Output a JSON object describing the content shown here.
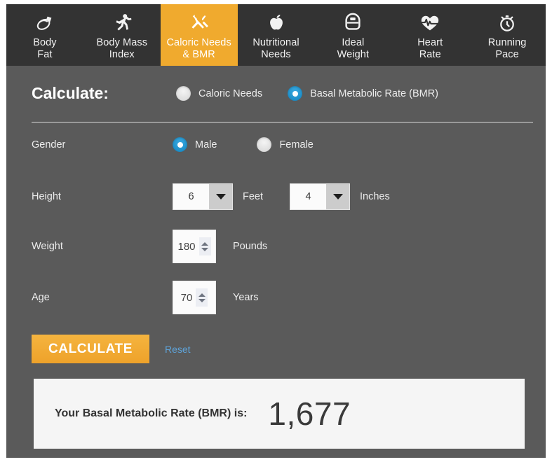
{
  "tabs": [
    {
      "label": "Body\nFat",
      "icon": "caliper-icon",
      "active": false
    },
    {
      "label": "Body Mass\nIndex",
      "icon": "runner-icon",
      "active": false
    },
    {
      "label": "Caloric Needs\n& BMR",
      "icon": "cutlery-icon",
      "active": true
    },
    {
      "label": "Nutritional\nNeeds",
      "icon": "apple-icon",
      "active": false
    },
    {
      "label": "Ideal\nWeight",
      "icon": "scale-icon",
      "active": false
    },
    {
      "label": "Heart\nRate",
      "icon": "heart-pulse-icon",
      "active": false
    },
    {
      "label": "Running\nPace",
      "icon": "stopwatch-icon",
      "active": false
    }
  ],
  "calculate": {
    "title": "Calculate:",
    "options": [
      {
        "label": "Caloric Needs",
        "selected": false
      },
      {
        "label": "Basal Metabolic Rate (BMR)",
        "selected": true
      }
    ]
  },
  "form": {
    "gender": {
      "label": "Gender",
      "options": [
        {
          "label": "Male",
          "selected": true
        },
        {
          "label": "Female",
          "selected": false
        }
      ]
    },
    "height": {
      "label": "Height",
      "feet": {
        "value": "6",
        "unit": "Feet"
      },
      "inches": {
        "value": "4",
        "unit": "Inches"
      }
    },
    "weight": {
      "label": "Weight",
      "value": "180",
      "unit": "Pounds"
    },
    "age": {
      "label": "Age",
      "value": "70",
      "unit": "Years"
    }
  },
  "actions": {
    "calculate_label": "CALCULATE",
    "reset_label": "Reset"
  },
  "result": {
    "label": "Your Basal Metabolic Rate (BMR) is:",
    "value": "1,677"
  },
  "colors": {
    "accent": "#f0aa2e",
    "tabbar_bg": "#333333",
    "body_bg": "#5a5a5a",
    "radio_on": "#1e8fc9",
    "link": "#5ea3d8",
    "result_bg": "#f5f5f5"
  }
}
